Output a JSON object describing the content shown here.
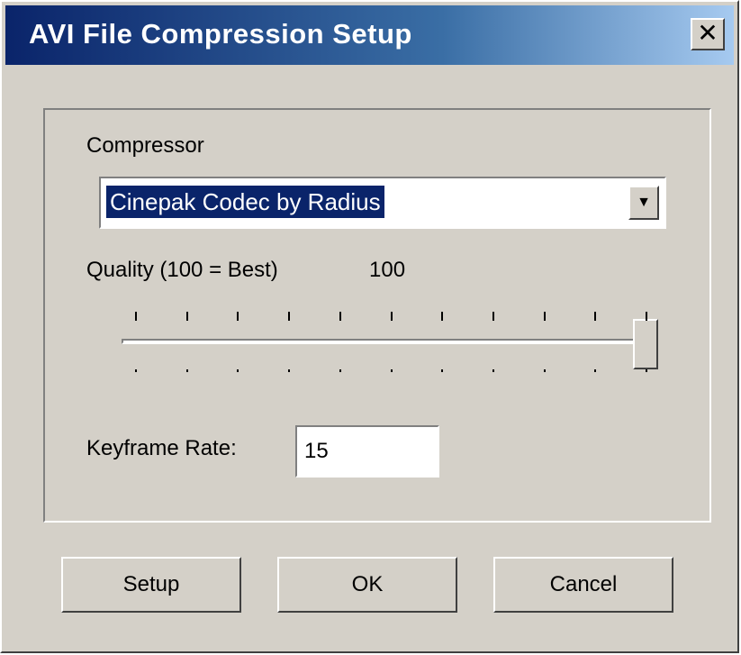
{
  "window": {
    "title": "AVI File Compression Setup",
    "close_glyph": "✕"
  },
  "compressor": {
    "label": "Compressor",
    "selected": "Cinepak Codec by Radius",
    "dropdown_glyph": "▼"
  },
  "quality": {
    "label": "Quality (100 = Best)",
    "value_text": "100",
    "value": 100,
    "min": 0,
    "max": 100
  },
  "keyframe": {
    "label": "Keyframe Rate:",
    "value": "15"
  },
  "buttons": {
    "setup": "Setup",
    "ok": "OK",
    "cancel": "Cancel"
  },
  "colors": {
    "face": "#d4d0c8",
    "title_start": "#0a246a",
    "title_end": "#a6caf0",
    "selection": "#0a246a"
  }
}
